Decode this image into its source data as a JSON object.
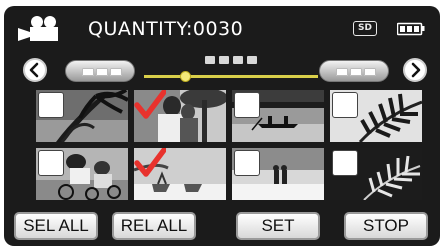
{
  "header": {
    "mode_icon": "video-camera-icon",
    "title": "QUANTITY:0030",
    "media_badge": "SD",
    "battery_icon": "battery-full-icon"
  },
  "navigation": {
    "prev_icon": "chevron-left-icon",
    "next_icon": "chevron-right-icon",
    "scroll_position": 0.25
  },
  "thumbnails": [
    {
      "scene": "palm-trees",
      "checked": false
    },
    {
      "scene": "couple-with-tree",
      "checked": true
    },
    {
      "scene": "canoe-on-lake",
      "checked": false
    },
    {
      "scene": "palm-leaves",
      "checked": false
    },
    {
      "scene": "cyclists",
      "checked": false
    },
    {
      "scene": "beach-chairs",
      "checked": true
    },
    {
      "scene": "couple-on-beach",
      "checked": false
    },
    {
      "scene": "palm-branch",
      "checked": false
    }
  ],
  "buttons": {
    "sel_all": "SEL ALL",
    "rel_all": "REL ALL",
    "set": "SET",
    "stop": "STOP"
  },
  "colors": {
    "panel": "#1b1b1b",
    "checkmark": "#e8322d",
    "track": "#d9cf4a"
  }
}
